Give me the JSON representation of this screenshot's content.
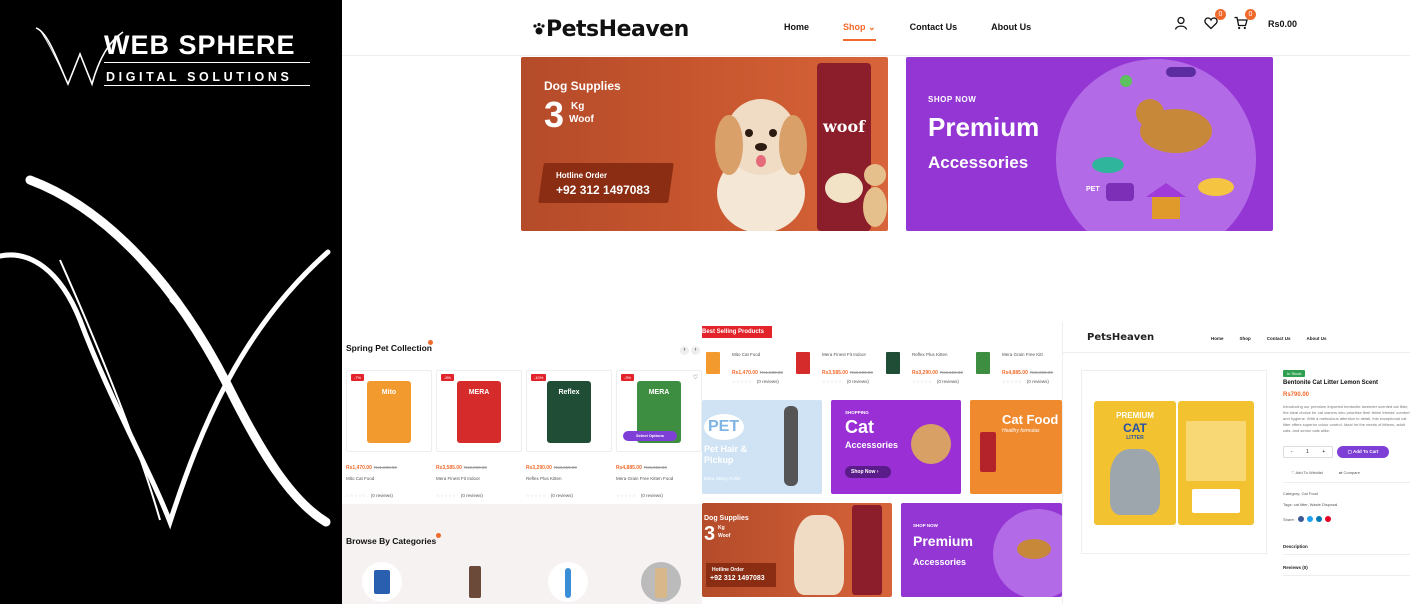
{
  "brand": {
    "name": "WEB SPHERE",
    "tagline": "DIGITAL SOLUTIONS"
  },
  "site": {
    "logo_text": "PetsHeaven",
    "nav": [
      "Home",
      "Shop",
      "Contact Us",
      "About Us"
    ],
    "shop_caret": "⌄",
    "wishlist_count": "0",
    "cart_count": "0",
    "cart_total": "Rs0.00"
  },
  "banner_dog": {
    "heading": "Dog Supplies",
    "qty_number": "3",
    "qty_unit": "Kg",
    "qty_label": "Woof",
    "hotline_label": "Hotline Order",
    "hotline_number": "+92 312 1497083",
    "bag_brand": "woof"
  },
  "banner_accessories": {
    "kicker": "SHOP NOW",
    "title": "Premium",
    "subtitle": "Accessories",
    "pet_tag": "PET"
  },
  "spring": {
    "title": "Spring Pet Collection",
    "products": [
      {
        "badge": "-7%",
        "price": "Rs1,470.00",
        "old": "Rs1,580.00",
        "name": "Mito Cat Food",
        "reviews": "(0 reviews)",
        "color": "#f29a2e",
        "label": "Mito"
      },
      {
        "badge": "-8%",
        "price": "Rs3,585.00",
        "old": "Rs3,900.00",
        "name": "Mera Finest Fit Indoor",
        "reviews": "(0 reviews)",
        "color": "#d62b2b",
        "label": "MERA"
      },
      {
        "badge": "-10%",
        "price": "Rs3,290.00",
        "old": "Rs3,650.00",
        "name": "Reflex Plus Kitten",
        "reviews": "(0 reviews)",
        "color": "#1f4d35",
        "label": "Reflex"
      },
      {
        "badge": "-3%",
        "price": "Rs4,885.00",
        "old": "Rs5,050.00",
        "name": "Mera Grain Free Kitten Food",
        "reviews": "(0 reviews)",
        "color": "#3e8e41",
        "label": "MERA"
      }
    ],
    "select_options": "Select Options"
  },
  "browse": {
    "title": "Browse By Categories"
  },
  "best": {
    "title": "Best Selling Products",
    "items": [
      {
        "name": "Mito Cat Food",
        "price": "Rs1,470.00",
        "old": "Rs1,580.00",
        "reviews": "(0 reviews)"
      },
      {
        "name": "Mera Finest Fit Indoor",
        "price": "Rs3,585.00",
        "old": "Rs3,900.00",
        "reviews": "(0 reviews)"
      },
      {
        "name": "Reflex Plus Kitten",
        "price": "Rs3,290.00",
        "old": "Rs3,650.00",
        "reviews": "(0 reviews)"
      },
      {
        "name": "Mera Grain Free Kitt",
        "price": "Rs4,885.00",
        "old": "Rs5,050.00",
        "reviews": "(0 reviews)"
      }
    ]
  },
  "promos": {
    "pet_title": "PET",
    "pet_sub": "Pet Hair & Pickup",
    "pet_small": "Extra Sticky Roller",
    "cat_kicker": "SHOPPING",
    "cat_title": "Cat",
    "cat_sub": "Accessories",
    "cat_btn": "Shop Now",
    "catfood_title": "Cat Food",
    "catfood_sub": "Healthy formulas"
  },
  "product_page": {
    "nav": [
      "Home",
      "Shop",
      "Contact Us",
      "About Us"
    ],
    "stock": "In Stock",
    "title": "Bentonite Cat Litter Lemon Scent",
    "price": "Rs790.00",
    "desc": "Introducing our premium imported bentonite lavender scented cat litter, the ideal choice for cat owners who prioritize their feline friends' comfort and hygiene. With a meticulous attention to detail, this exceptional cat litter offers superior odour control. Ideal for the needs of kittens, adult cats, and senior cats alike.",
    "qty": "1",
    "minus": "-",
    "plus": "+",
    "add_to_cart": "Add To Cart",
    "wishlist": "Add To Wishlist",
    "compare": "Compare",
    "category": "Category: Cat Food",
    "tags": "Tags: cat litter, Waste Disposal",
    "share": "Share:",
    "tab_desc": "Description",
    "tab_reviews": "Reviews (0)",
    "bag_line1": "PREMIUM",
    "bag_line2": "CAT",
    "bag_line3": "LITTER"
  }
}
